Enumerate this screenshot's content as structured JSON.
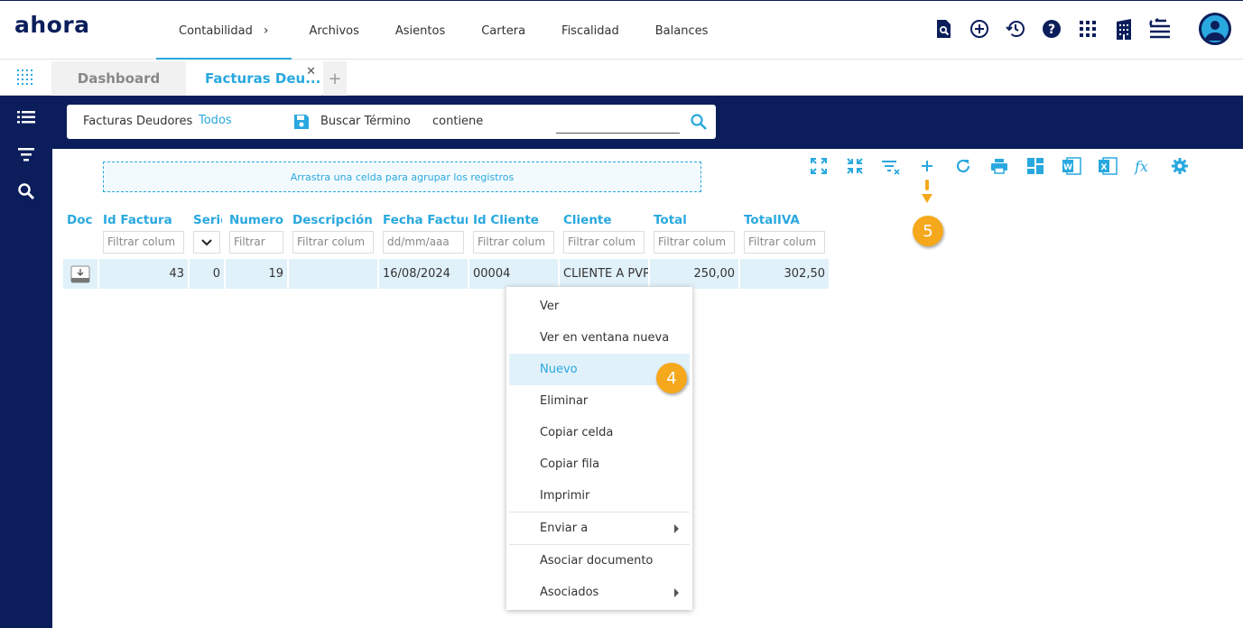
{
  "app": {
    "logo": "ahora"
  },
  "nav": {
    "items": [
      "Contabilidad",
      "Archivos",
      "Asientos",
      "Cartera",
      "Fiscalidad",
      "Balances"
    ]
  },
  "top_icons": [
    "document-search-icon",
    "add-circle-icon",
    "history-icon",
    "help-icon",
    "apps-grid-icon",
    "building-icon",
    "swap-settings-icon"
  ],
  "tabs": [
    {
      "label": "Dashboard"
    },
    {
      "label": "Facturas Deu..."
    }
  ],
  "search": {
    "label": "Facturas Deudores",
    "scope": "Todos",
    "buscar": "Buscar Término",
    "operator": "contiene",
    "value": ""
  },
  "group_panel": {
    "text": "Arrastra una celda para agrupar los registros"
  },
  "toolbar_icons": [
    "expand-icon",
    "collapse-icon",
    "clear-filter-icon",
    "add-icon",
    "refresh-icon",
    "print-icon",
    "layout-icon",
    "word-icon",
    "excel-icon",
    "formula-icon",
    "settings-icon"
  ],
  "grid": {
    "columns": [
      "Doc",
      "Id Factura",
      "Serie",
      "Numero Fa",
      "Descripción Fact",
      "Fecha Factura",
      "Id Cliente",
      "Cliente",
      "Total",
      "TotalIVA"
    ],
    "filters": {
      "id_factura": "Filtrar colum",
      "numero": "Filtrar",
      "descripcion": "Filtrar colum",
      "fecha": "dd/mm/aaa",
      "id_cliente": "Filtrar colum",
      "cliente": "Filtrar colum",
      "total": "Filtrar colum",
      "totaliva": "Filtrar colum"
    },
    "rows": [
      {
        "id_factura": "43",
        "serie": "0",
        "numero": "19",
        "descripcion": "",
        "fecha": "16/08/2024",
        "id_cliente": "00004",
        "cliente": "CLIENTE A PVP",
        "total": "250,00",
        "totaliva": "302,50"
      }
    ]
  },
  "context_menu": {
    "items": [
      "Ver",
      "Ver en ventana nueva",
      "Nuevo",
      "Eliminar",
      "Copiar celda",
      "Copiar fila",
      "Imprimir",
      "Enviar a",
      "Asociar documento",
      "Asociados"
    ],
    "highlighted": "Nuevo"
  },
  "badges": {
    "step4": "4",
    "step5": "5"
  },
  "colors": {
    "navy": "#0b1e5b",
    "accent": "#29a8df",
    "badge": "#f6a81c",
    "row": "#e1f1fa"
  }
}
